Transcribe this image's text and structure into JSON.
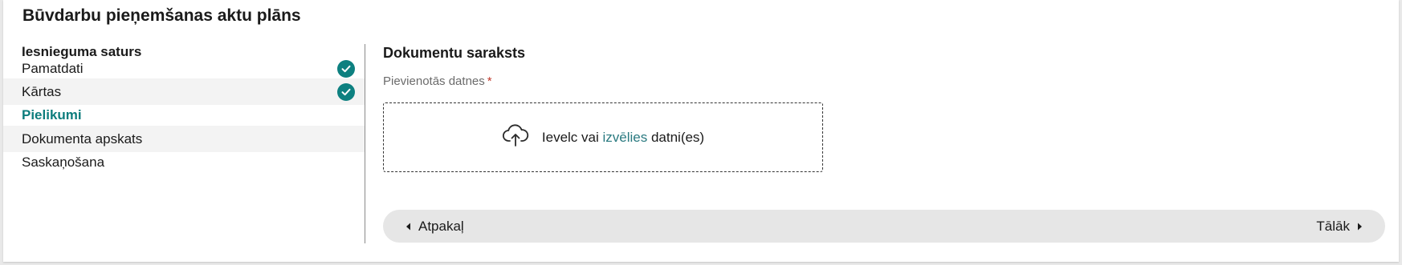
{
  "page": {
    "title": "Būvdarbu pieņemšanas aktu plāns"
  },
  "sidebar": {
    "heading": "Iesnieguma saturs",
    "items": [
      {
        "label": "Pamatdati",
        "completed": true
      },
      {
        "label": "Kārtas",
        "completed": true
      },
      {
        "label": "Pielikumi",
        "active": true
      },
      {
        "label": "Dokumenta apskats"
      },
      {
        "label": "Saskaņošana"
      }
    ]
  },
  "main": {
    "section_title": "Dokumentu saraksts",
    "field_label": "Pievienotās datnes",
    "required_mark": "*",
    "dropzone": {
      "icon": "cloud-upload-icon",
      "text_before": "Ievelc vai ",
      "link": "izvēlies",
      "text_after": " datni(es)"
    },
    "nav": {
      "back": "Atpakaļ",
      "next": "Tālāk"
    }
  },
  "colors": {
    "accent": "#0d7d7d",
    "check_bg": "#0d8080",
    "required": "#c0392b"
  }
}
